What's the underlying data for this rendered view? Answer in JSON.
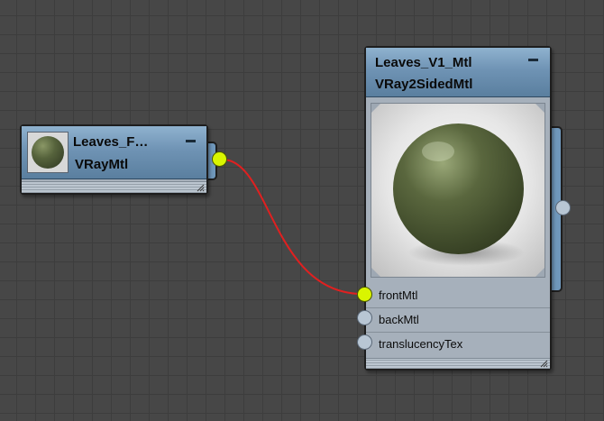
{
  "nodes": {
    "source": {
      "title": "Leaves_F…",
      "type": "VRayMtl"
    },
    "target": {
      "title": "Leaves_V1_Mtl",
      "type": "VRay2SidedMtl",
      "slots": [
        {
          "label": "frontMtl",
          "connected": true
        },
        {
          "label": "backMtl",
          "connected": false
        },
        {
          "label": "translucencyTex",
          "connected": false
        }
      ]
    }
  },
  "colors": {
    "wire": "#e02020",
    "socket_active": "#d9f500",
    "socket_idle": "#b8c6d4",
    "header_blue": "#6f93b4",
    "material_green": "#4e5a37"
  },
  "icons": [
    "collapse-icon",
    "resize-grip-icon",
    "material-sphere-thumbnail"
  ]
}
